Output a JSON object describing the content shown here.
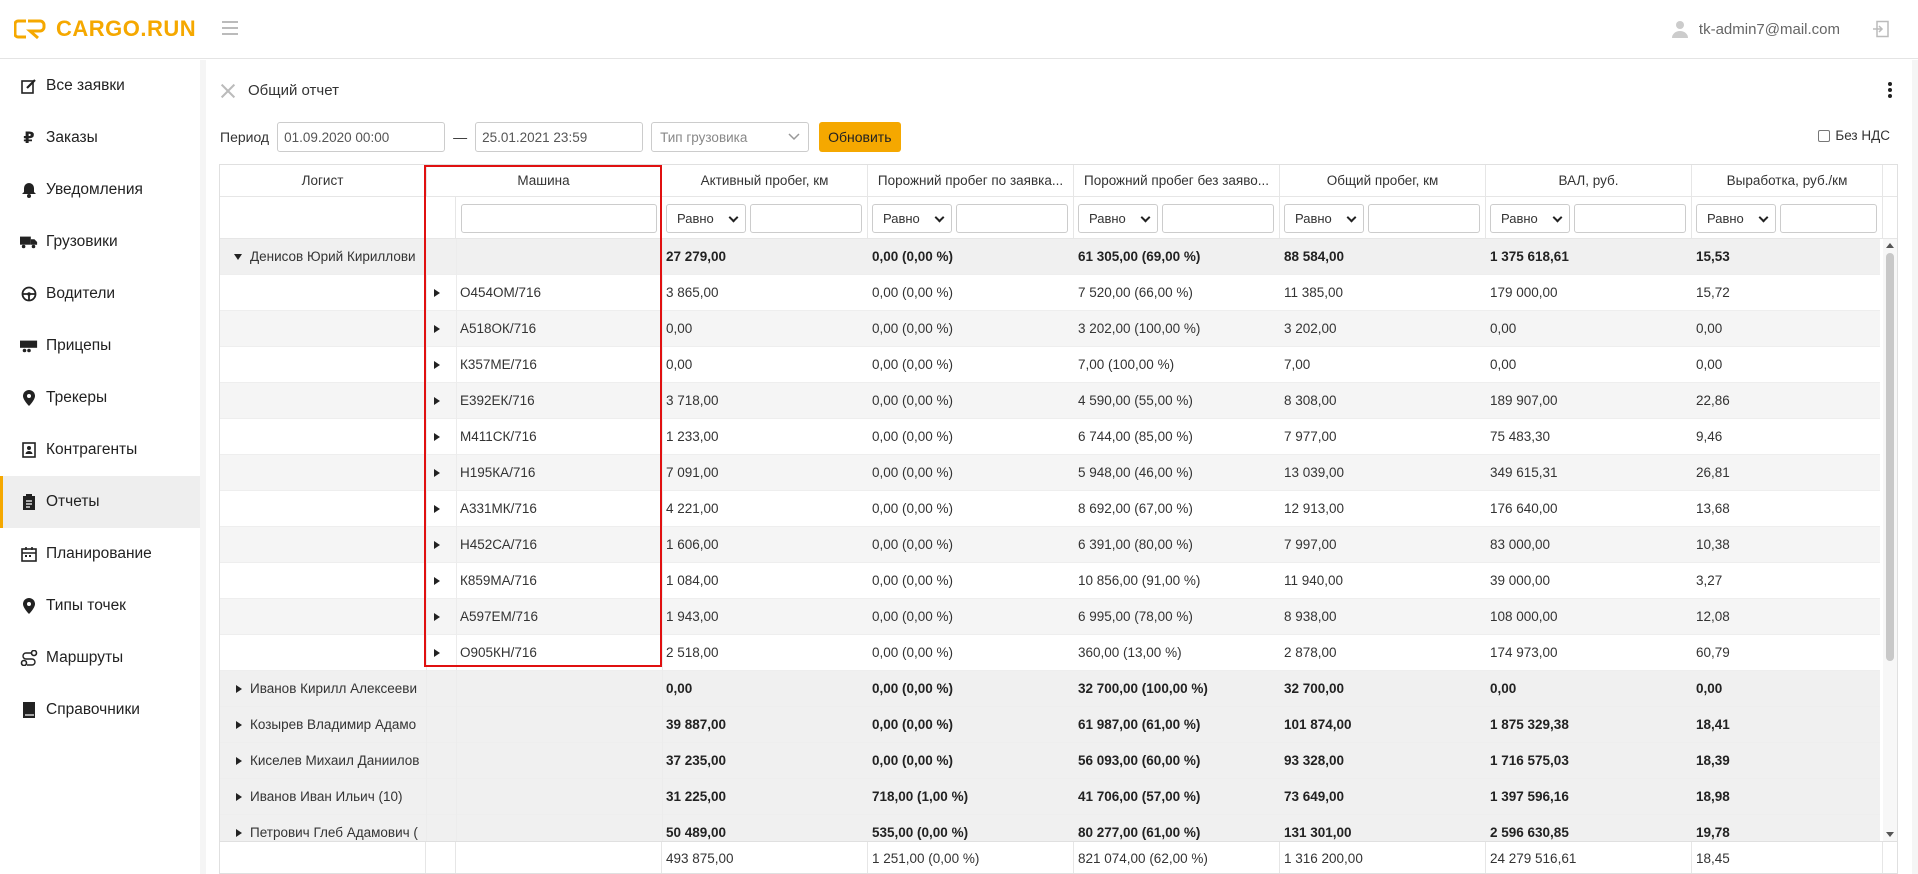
{
  "app": {
    "logo_text": "CARGO.RUN"
  },
  "header": {
    "user_email": "tk-admin7@mail.com"
  },
  "sidebar": {
    "items": [
      {
        "label": "Все заявки",
        "icon": "edit-icon"
      },
      {
        "label": "Заказы",
        "icon": "ruble-icon"
      },
      {
        "label": "Уведомления",
        "icon": "bell-icon"
      },
      {
        "label": "Грузовики",
        "icon": "truck-icon"
      },
      {
        "label": "Водители",
        "icon": "steering-wheel-icon"
      },
      {
        "label": "Прицепы",
        "icon": "trailer-icon"
      },
      {
        "label": "Трекеры",
        "icon": "map-pin-icon"
      },
      {
        "label": "Контрагенты",
        "icon": "contacts-icon"
      },
      {
        "label": "Отчеты",
        "icon": "clipboard-icon",
        "active": true
      },
      {
        "label": "Планирование",
        "icon": "calendar-icon"
      },
      {
        "label": "Типы точек",
        "icon": "location-icon"
      },
      {
        "label": "Маршруты",
        "icon": "route-icon"
      },
      {
        "label": "Справочники",
        "icon": "book-icon"
      }
    ]
  },
  "report": {
    "title": "Общий отчет",
    "period_label": "Период",
    "date_from": "01.09.2020 00:00",
    "date_dash": "—",
    "date_to": "25.01.2021 23:59",
    "truck_type_placeholder": "Тип грузовика",
    "refresh_label": "Обновить",
    "vat_label": "Без НДС"
  },
  "table": {
    "columns": [
      "Логист",
      "Машина",
      "Активный пробег, км",
      "Порожний пробег по заявка...",
      "Порожний пробег без заяво...",
      "Общий пробег, км",
      "ВАЛ, руб.",
      "Выработка, руб./км"
    ],
    "filter_operator": "Равно",
    "rows": [
      {
        "type": "group",
        "expanded": true,
        "logist": "Денисов Юрий Кириллови",
        "car": "",
        "values": [
          "27 279,00",
          "0,00 (0,00 %)",
          "61 305,00 (69,00 %)",
          "88 584,00",
          "1 375 618,61",
          "15,53"
        ]
      },
      {
        "type": "item",
        "car": "О454ОМ/716",
        "values": [
          "3 865,00",
          "0,00 (0,00 %)",
          "7 520,00 (66,00 %)",
          "11 385,00",
          "179 000,00",
          "15,72"
        ]
      },
      {
        "type": "item",
        "car": "А518ОК/716",
        "values": [
          "0,00",
          "0,00 (0,00 %)",
          "3 202,00 (100,00 %)",
          "3 202,00",
          "0,00",
          "0,00"
        ]
      },
      {
        "type": "item",
        "car": "К357МЕ/716",
        "values": [
          "0,00",
          "0,00 (0,00 %)",
          "7,00 (100,00 %)",
          "7,00",
          "0,00",
          "0,00"
        ]
      },
      {
        "type": "item",
        "car": "Е392ЕК/716",
        "values": [
          "3 718,00",
          "0,00 (0,00 %)",
          "4 590,00 (55,00 %)",
          "8 308,00",
          "189 907,00",
          "22,86"
        ]
      },
      {
        "type": "item",
        "car": "М411СК/716",
        "values": [
          "1 233,00",
          "0,00 (0,00 %)",
          "6 744,00 (85,00 %)",
          "7 977,00",
          "75 483,30",
          "9,46"
        ]
      },
      {
        "type": "item",
        "car": "Н195КА/716",
        "values": [
          "7 091,00",
          "0,00 (0,00 %)",
          "5 948,00 (46,00 %)",
          "13 039,00",
          "349 615,31",
          "26,81"
        ]
      },
      {
        "type": "item",
        "car": "А331МК/716",
        "values": [
          "4 221,00",
          "0,00 (0,00 %)",
          "8 692,00 (67,00 %)",
          "12 913,00",
          "176 640,00",
          "13,68"
        ]
      },
      {
        "type": "item",
        "car": "Н452СА/716",
        "values": [
          "1 606,00",
          "0,00 (0,00 %)",
          "6 391,00 (80,00 %)",
          "7 997,00",
          "83 000,00",
          "10,38"
        ]
      },
      {
        "type": "item",
        "car": "К859МА/716",
        "values": [
          "1 084,00",
          "0,00 (0,00 %)",
          "10 856,00 (91,00 %)",
          "11 940,00",
          "39 000,00",
          "3,27"
        ]
      },
      {
        "type": "item",
        "car": "А597ЕМ/716",
        "values": [
          "1 943,00",
          "0,00 (0,00 %)",
          "6 995,00 (78,00 %)",
          "8 938,00",
          "108 000,00",
          "12,08"
        ]
      },
      {
        "type": "item",
        "car": "О905КН/716",
        "values": [
          "2 518,00",
          "0,00 (0,00 %)",
          "360,00 (13,00 %)",
          "2 878,00",
          "174 973,00",
          "60,79"
        ]
      },
      {
        "type": "group",
        "expanded": false,
        "logist": "Иванов Кирилл Алексееви",
        "car": "",
        "values": [
          "0,00",
          "0,00 (0,00 %)",
          "32 700,00 (100,00 %)",
          "32 700,00",
          "0,00",
          "0,00"
        ]
      },
      {
        "type": "group",
        "expanded": false,
        "logist": "Козырев Владимир Адамо",
        "car": "",
        "values": [
          "39 887,00",
          "0,00 (0,00 %)",
          "61 987,00 (61,00 %)",
          "101 874,00",
          "1 875 329,38",
          "18,41"
        ]
      },
      {
        "type": "group",
        "expanded": false,
        "logist": "Киселев Михаил Даниилов",
        "car": "",
        "values": [
          "37 235,00",
          "0,00 (0,00 %)",
          "56 093,00 (60,00 %)",
          "93 328,00",
          "1 716 575,03",
          "18,39"
        ]
      },
      {
        "type": "group",
        "expanded": false,
        "logist": "Иванов Иван Ильич (10)",
        "car": "",
        "values": [
          "31 225,00",
          "718,00 (1,00 %)",
          "41 706,00 (57,00 %)",
          "73 649,00",
          "1 397 596,16",
          "18,98"
        ]
      },
      {
        "type": "group",
        "expanded": false,
        "logist": "Петрович Глеб Адамович (",
        "car": "",
        "values": [
          "50 489,00",
          "535,00 (0,00 %)",
          "80 277,00 (61,00 %)",
          "131 301,00",
          "2 596 630,85",
          "19,78"
        ]
      }
    ],
    "totals": [
      "493 875,00",
      "1 251,00 (0,00 %)",
      "821 074,00 (62,00 %)",
      "1 316 200,00",
      "24 279 516,61",
      "18,45"
    ]
  }
}
